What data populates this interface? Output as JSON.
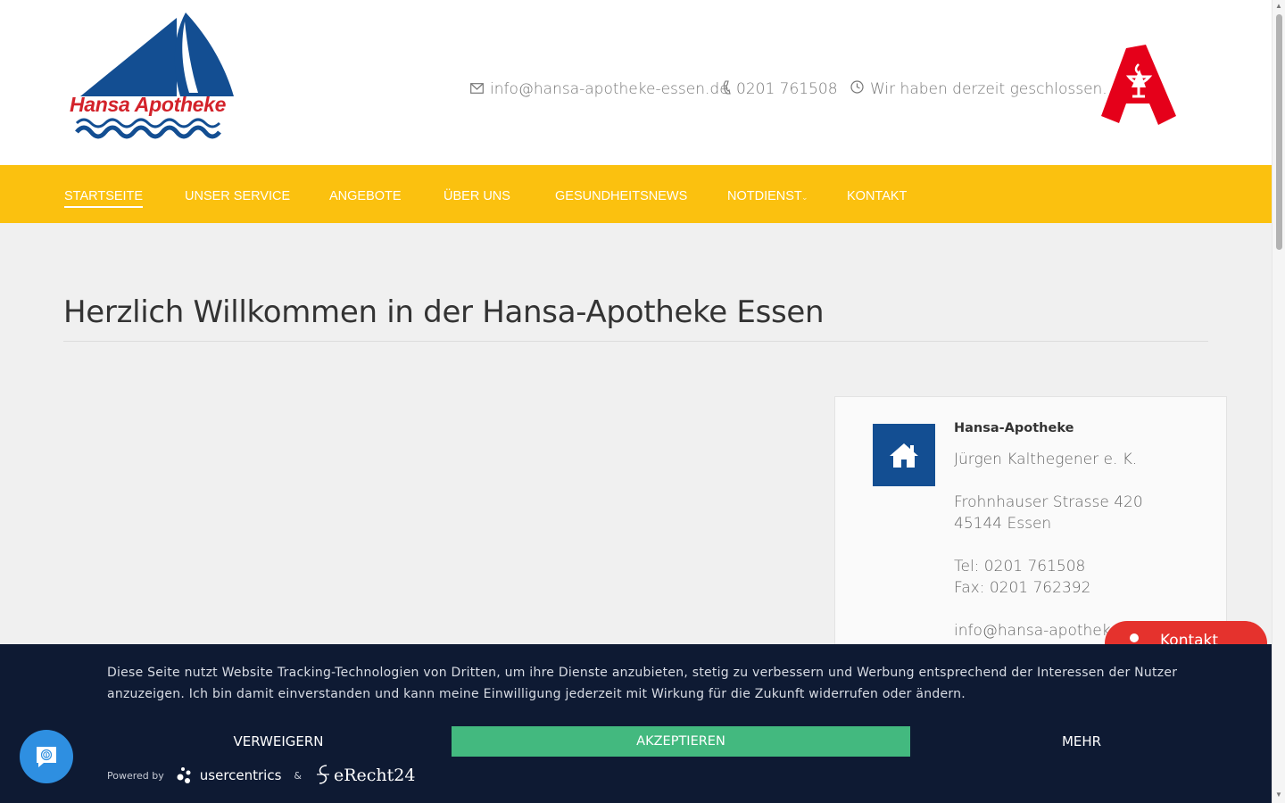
{
  "brand": {
    "logo_text": "Hansa Apotheke",
    "logo_blue": "#134e92",
    "logo_red": "#d3222a"
  },
  "header": {
    "email": "info@hansa-apotheke-essen.de",
    "phone": "0201 761508",
    "status": "Wir haben derzeit geschlossen."
  },
  "nav": {
    "items": [
      {
        "label": "Startseite",
        "active": true
      },
      {
        "label": "Unser Service",
        "has_dropdown": true
      },
      {
        "label": "Angebote"
      },
      {
        "label": "Über uns"
      },
      {
        "label": "Gesundheitsnews"
      },
      {
        "label": "Notdienst",
        "has_dropdown": true
      },
      {
        "label": "Kontakt"
      }
    ],
    "color": "#fbc10f"
  },
  "main": {
    "title": "Herzlich Willkommen in der Hansa-Apotheke Essen"
  },
  "card": {
    "name": "Hansa-Apotheke",
    "owner": "Jürgen Kalthegener e. K.",
    "street": "Frohnhauser Strasse 420",
    "city": "45144 Essen",
    "tel": "Tel: 0201 761508",
    "fax": "Fax: 0201 762392",
    "email": "info@hansa-apotheke-"
  },
  "kontakt_button": {
    "label": "Kontakt",
    "color": "#e5322d"
  },
  "cookie": {
    "text": "Diese Seite nutzt Website Tracking-Technologien von Dritten, um ihre Dienste anzubieten, stetig zu verbessern und Werbung entsprechend der Interessen der Nutzer anzuzeigen. Ich bin damit einverstanden und kann meine Einwilligung jederzeit mit Wirkung für die Zukunft widerrufen oder ändern.",
    "deny": "Verweigern",
    "accept": "Akzeptieren",
    "more": "Mehr",
    "powered_by": "Powered by",
    "provider": "usercentrics",
    "amp": "&",
    "partner": "eRecht24",
    "bg": "#0e1a33",
    "accept_color": "#43b97f"
  }
}
